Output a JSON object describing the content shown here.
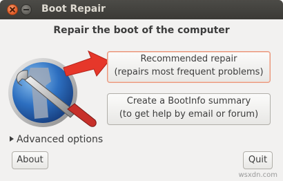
{
  "window": {
    "title": "Boot Repair"
  },
  "main": {
    "heading": "Repair the boot of the computer",
    "recommended": {
      "line1": "Recommended repair",
      "line2": "(repairs most frequent problems)"
    },
    "bootinfo": {
      "line1": "Create a BootInfo summary",
      "line2": "(to get help by email or forum)"
    },
    "advanced_label": "Advanced options"
  },
  "footer": {
    "about_label": "About",
    "quit_label": "Quit"
  },
  "watermark": "wsxdn.com",
  "colors": {
    "titlebar": "#3c3b37",
    "window_bg": "#f2f1f0",
    "accent_arrow": "#e6372a",
    "highlight_border": "#e9967b"
  },
  "icons": {
    "logo": "boot-repair-logo-icon",
    "arrow": "red-arrow-icon"
  }
}
